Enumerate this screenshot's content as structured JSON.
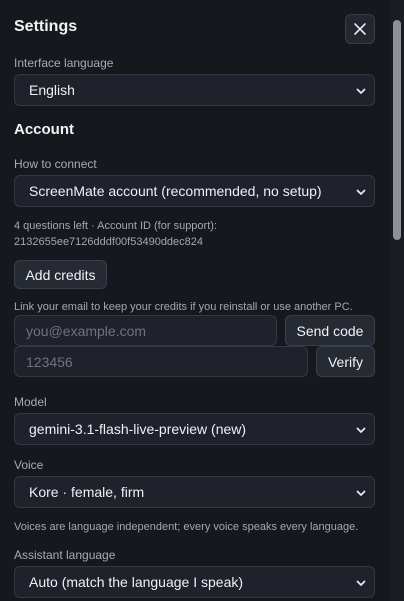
{
  "header": {
    "title": "Settings"
  },
  "interface_language": {
    "label": "Interface language",
    "value": "English"
  },
  "account": {
    "section_title": "Account",
    "connect_label": "How to connect",
    "connect_value": "ScreenMate account (recommended, no setup)",
    "info_line1": "4 questions left · Account ID (for support):",
    "info_line2": "2132655ee7126dddf00f53490ddec824",
    "add_credits_label": "Add credits",
    "link_email_text": "Link your email to keep your credits if you reinstall or use another PC.",
    "email_placeholder": "you@example.com",
    "send_code_label": "Send code",
    "code_placeholder": "123456",
    "verify_label": "Verify"
  },
  "model": {
    "label": "Model",
    "value": "gemini-3.1-flash-live-preview (new)"
  },
  "voice": {
    "label": "Voice",
    "value": "Kore · female, firm",
    "note": "Voices are language independent; every voice speaks every language."
  },
  "assistant_language": {
    "label": "Assistant language",
    "value": "Auto (match the language I speak)"
  },
  "icons": {
    "close": "close-icon",
    "dropdown": "chevron-down-icon"
  },
  "colors": {
    "background": "#17181d",
    "field": "#1f222b",
    "border": "#343845",
    "button": "#262a33"
  }
}
